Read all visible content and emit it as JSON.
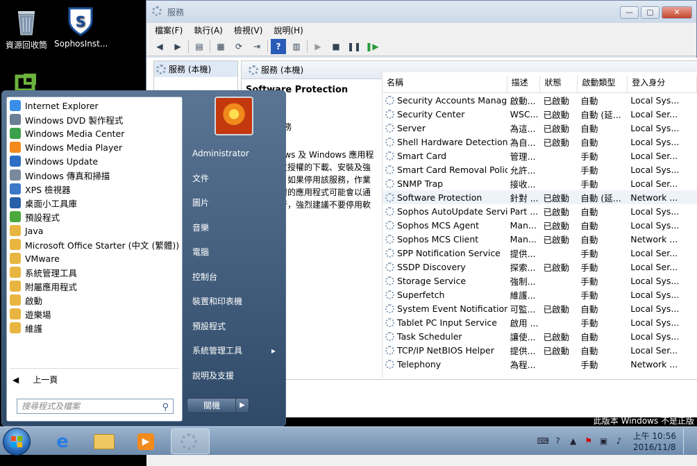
{
  "desktop": {
    "icons": [
      {
        "label": "資源回收筒"
      },
      {
        "label": "SophosInst..."
      }
    ]
  },
  "services_window": {
    "title": "服務",
    "menu": [
      "檔案(F)",
      "執行(A)",
      "檢視(V)",
      "說明(H)"
    ],
    "tree_root": "服務 (本機)",
    "pane_header": "服務 (本機)",
    "selected_service_title": "Software Protection",
    "desc_fragment_1": "務",
    "desc_fragment_2": "ows 及 Windows 應用程\n位授權的下載、安裝及強\n。如果停用該服務，作業\n權的應用程式可能會以通\n行，強烈建議不要停用軟\n。",
    "columns": [
      "名稱",
      "描述",
      "狀態",
      "啟動類型",
      "登入身分"
    ],
    "rows": [
      {
        "name": "Security Accounts Manager",
        "desc": "啟動...",
        "status": "已啟動",
        "startup": "自動",
        "logon": "Local Sys..."
      },
      {
        "name": "Security Center",
        "desc": "WSC...",
        "status": "已啟動",
        "startup": "自動 (延...",
        "logon": "Local Ser..."
      },
      {
        "name": "Server",
        "desc": "為這...",
        "status": "已啟動",
        "startup": "自動",
        "logon": "Local Sys..."
      },
      {
        "name": "Shell Hardware Detection",
        "desc": "為自...",
        "status": "已啟動",
        "startup": "自動",
        "logon": "Local Sys..."
      },
      {
        "name": "Smart Card",
        "desc": "管理...",
        "status": "",
        "startup": "手動",
        "logon": "Local Ser..."
      },
      {
        "name": "Smart Card Removal Policy",
        "desc": "允許...",
        "status": "",
        "startup": "手動",
        "logon": "Local Sys..."
      },
      {
        "name": "SNMP Trap",
        "desc": "接收...",
        "status": "",
        "startup": "手動",
        "logon": "Local Ser..."
      },
      {
        "name": "Software Protection",
        "desc": "針對 ...",
        "status": "已啟動",
        "startup": "自動 (延...",
        "logon": "Network ..."
      },
      {
        "name": "Sophos AutoUpdate Servi...",
        "desc": "Part ...",
        "status": "已啟動",
        "startup": "自動",
        "logon": "Local Sys..."
      },
      {
        "name": "Sophos MCS Agent",
        "desc": "Man...",
        "status": "已啟動",
        "startup": "自動",
        "logon": "Local Sys..."
      },
      {
        "name": "Sophos MCS Client",
        "desc": "Man...",
        "status": "已啟動",
        "startup": "自動",
        "logon": "Network ..."
      },
      {
        "name": "SPP Notification Service",
        "desc": "提供...",
        "status": "",
        "startup": "手動",
        "logon": "Local Ser..."
      },
      {
        "name": "SSDP Discovery",
        "desc": "探索...",
        "status": "已啟動",
        "startup": "手動",
        "logon": "Local Ser..."
      },
      {
        "name": "Storage Service",
        "desc": "強制...",
        "status": "",
        "startup": "手動",
        "logon": "Local Sys..."
      },
      {
        "name": "Superfetch",
        "desc": "維護...",
        "status": "",
        "startup": "手動",
        "logon": "Local Sys..."
      },
      {
        "name": "System Event Notification...",
        "desc": "可監...",
        "status": "已啟動",
        "startup": "自動",
        "logon": "Local Sys..."
      },
      {
        "name": "Tablet PC Input Service",
        "desc": "啟用 ...",
        "status": "",
        "startup": "手動",
        "logon": "Local Sys..."
      },
      {
        "name": "Task Scheduler",
        "desc": "讓使...",
        "status": "已啟動",
        "startup": "自動",
        "logon": "Local Sys..."
      },
      {
        "name": "TCP/IP NetBIOS Helper",
        "desc": "提供...",
        "status": "已啟動",
        "startup": "自動",
        "logon": "Local Ser..."
      },
      {
        "name": "Telephony",
        "desc": "為程...",
        "status": "",
        "startup": "手動",
        "logon": "Network ..."
      }
    ]
  },
  "start_menu": {
    "programs": [
      {
        "label": "Internet Explorer",
        "color": "#3a8ee6"
      },
      {
        "label": "Windows DVD 製作程式",
        "color": "#6a7f96"
      },
      {
        "label": "Windows Media Center",
        "color": "#3aa14a"
      },
      {
        "label": "Windows Media Player",
        "color": "#f28a1c"
      },
      {
        "label": "Windows Update",
        "color": "#2a6fc4"
      },
      {
        "label": "Windows 傳真和掃描",
        "color": "#7a8a9c"
      },
      {
        "label": "XPS 檢視器",
        "color": "#3a78c8"
      },
      {
        "label": "桌面小工具庫",
        "color": "#2a5fa8"
      },
      {
        "label": "預設程式",
        "color": "#4caa3c"
      },
      {
        "label": "Java",
        "color": "#e8b640"
      },
      {
        "label": "Microsoft Office Starter (中文 (繁體))",
        "color": "#e8b640"
      },
      {
        "label": "VMware",
        "color": "#e8b640"
      },
      {
        "label": "系統管理工具",
        "color": "#e8b640"
      },
      {
        "label": "附屬應用程式",
        "color": "#e8b640"
      },
      {
        "label": "啟動",
        "color": "#e8b640"
      },
      {
        "label": "遊樂場",
        "color": "#e8b640"
      },
      {
        "label": "維護",
        "color": "#e8b640"
      }
    ],
    "back_label": "上一頁",
    "search_placeholder": "搜尋程式及檔案",
    "right_links": [
      {
        "label": "Administrator",
        "submenu": false
      },
      {
        "label": "文件",
        "submenu": false
      },
      {
        "label": "圖片",
        "submenu": false
      },
      {
        "label": "音樂",
        "submenu": false
      },
      {
        "label": "電腦",
        "submenu": false
      },
      {
        "label": "控制台",
        "submenu": false
      },
      {
        "label": "裝置和印表機",
        "submenu": false
      },
      {
        "label": "預設程式",
        "submenu": false
      },
      {
        "label": "系統管理工具",
        "submenu": true
      },
      {
        "label": "說明及支援",
        "submenu": false
      }
    ],
    "shutdown_label": "關機"
  },
  "taskbar": {
    "time": "上午 10:56",
    "date": "2016/11/8"
  },
  "watermark": "此版本 Windows 不是正版"
}
